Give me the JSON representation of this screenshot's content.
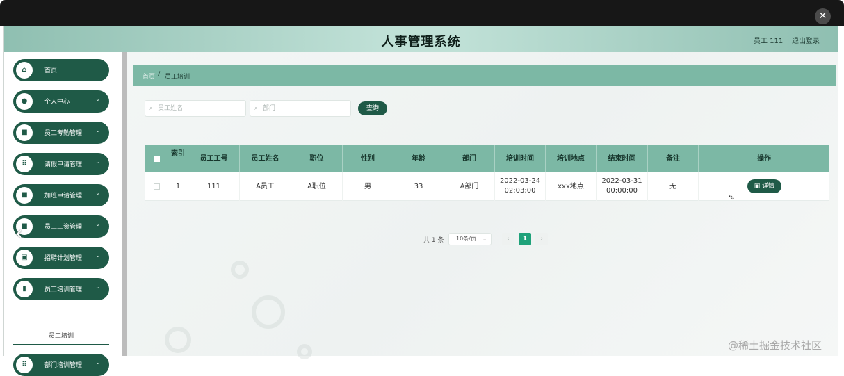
{
  "window": {
    "close_glyph": "✕"
  },
  "header": {
    "title": "人事管理系统",
    "user": "员工 111",
    "logout": "退出登录"
  },
  "sidebar": {
    "items": [
      {
        "label": "首页",
        "icon": "home-icon",
        "glyph": "⌂",
        "has_chevron": false
      },
      {
        "label": "个人中心",
        "icon": "user-icon",
        "glyph": "●",
        "has_chevron": true
      },
      {
        "label": "员工考勤管理",
        "icon": "attendance-icon",
        "glyph": "■",
        "has_chevron": true
      },
      {
        "label": "请假申请管理",
        "icon": "grid-icon",
        "glyph": "⠿",
        "has_chevron": true
      },
      {
        "label": "加班申请管理",
        "icon": "overtime-icon",
        "glyph": "■",
        "has_chevron": true
      },
      {
        "label": "员工工资管理",
        "icon": "salary-icon",
        "glyph": "■",
        "has_chevron": true
      },
      {
        "label": "招聘计划管理",
        "icon": "recruit-icon",
        "glyph": "▣",
        "has_chevron": true
      },
      {
        "label": "员工培训管理",
        "icon": "chart-icon",
        "glyph": "▮",
        "has_chevron": true
      },
      {
        "label": "部门培训管理",
        "icon": "grid-icon",
        "glyph": "⠿",
        "has_chevron": true
      }
    ],
    "submenu_active": "员工培训",
    "chevron": "⌄"
  },
  "breadcrumb": {
    "home": "首页",
    "separator": "/",
    "current": "员工培训"
  },
  "search": {
    "name_placeholder": "员工姓名",
    "dept_placeholder": "部门",
    "query_label": "查询"
  },
  "table": {
    "columns": [
      "索引",
      "员工工号",
      "员工姓名",
      "职位",
      "性别",
      "年龄",
      "部门",
      "培训时间",
      "培训地点",
      "结束时间",
      "备注",
      "操作"
    ],
    "rows": [
      {
        "index": "1",
        "emp_no": "111",
        "emp_name": "A员工",
        "position": "A职位",
        "gender": "男",
        "age": "33",
        "dept": "A部门",
        "train_time_date": "2022-03-24",
        "train_time_clock": "02:03:00",
        "location": "xxx地点",
        "end_time_date": "2022-03-31",
        "end_time_clock": "00:00:00",
        "note": "无",
        "action": "详情"
      }
    ]
  },
  "pagination": {
    "total": "共 1 条",
    "page_size": "10条/页",
    "current_page": "1",
    "prev": "‹",
    "next": "›"
  },
  "watermark": "@稀土掘金技术社区",
  "colors": {
    "primary": "#1f5a47",
    "table_header": "#7cb8a5",
    "active_page": "#1fa27a"
  }
}
